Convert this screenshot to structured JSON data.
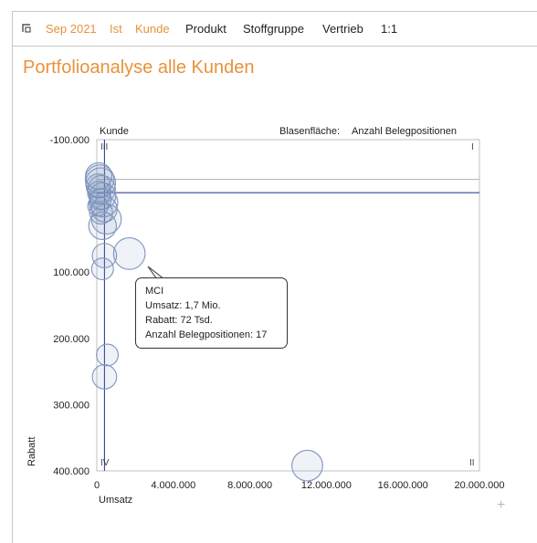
{
  "toolbar": {
    "items": [
      {
        "label": "Sep 2021",
        "accent": true
      },
      {
        "label": "Ist",
        "accent": true
      },
      {
        "label": "Kunde",
        "accent": true
      },
      {
        "label": "Produkt",
        "accent": false
      },
      {
        "label": "Stoffgruppe",
        "accent": false
      },
      {
        "label": "Vertrieb",
        "accent": false
      },
      {
        "label": "1:1",
        "accent": false
      }
    ]
  },
  "page_title": "Portfolioanalyse alle Kunden",
  "colors": {
    "accent": "#e8923a",
    "bubble": "#7f95bd",
    "mean_line": "#1f2d8f"
  },
  "chart_data": {
    "type": "scatter",
    "series_label": "Kunde",
    "size_label": "Blasenfläche:",
    "size_value": "Anzahl Belegpositionen",
    "xlabel": "Umsatz",
    "ylabel": "Rabatt",
    "xlim": [
      0,
      20000000
    ],
    "ylim": [
      -100000,
      400000
    ],
    "y_inverted": true,
    "x_ticks": [
      "0",
      "4.000.000",
      "8.000.000",
      "12.000.000",
      "16.000.000",
      "20.000.000"
    ],
    "y_ticks": [
      "-100.000",
      "100.000",
      "200.000",
      "300.000",
      "400.000"
    ],
    "quadrants": [
      "III",
      "I",
      "IV",
      "II"
    ],
    "mean_x": 400000,
    "mean_y": -20000,
    "ref_y": -40000,
    "points": [
      {
        "x": 100000,
        "y": -45000,
        "size": 12
      },
      {
        "x": 150000,
        "y": -40000,
        "size": 14
      },
      {
        "x": 200000,
        "y": -35000,
        "size": 15
      },
      {
        "x": 80000,
        "y": -30000,
        "size": 10
      },
      {
        "x": 250000,
        "y": -25000,
        "size": 13
      },
      {
        "x": 120000,
        "y": -20000,
        "size": 9
      },
      {
        "x": 300000,
        "y": -15000,
        "size": 12
      },
      {
        "x": 180000,
        "y": -10000,
        "size": 8
      },
      {
        "x": 350000,
        "y": -5000,
        "size": 14
      },
      {
        "x": 60000,
        "y": 0,
        "size": 7
      },
      {
        "x": 400000,
        "y": 5000,
        "size": 11
      },
      {
        "x": 220000,
        "y": 10000,
        "size": 9
      },
      {
        "x": 500000,
        "y": 20000,
        "size": 15
      },
      {
        "x": 300000,
        "y": 30000,
        "size": 13
      },
      {
        "x": 1700000,
        "y": 72000,
        "size": 17
      },
      {
        "x": 400000,
        "y": 75000,
        "size": 10
      },
      {
        "x": 300000,
        "y": 95000,
        "size": 8
      },
      {
        "x": 550000,
        "y": 225000,
        "size": 8
      },
      {
        "x": 400000,
        "y": 258000,
        "size": 10
      },
      {
        "x": 11000000,
        "y": 392000,
        "size": 16
      }
    ]
  },
  "tooltip": {
    "name": "MCI",
    "line1": "Umsatz: 1,7 Mio.",
    "line2": "Rabatt: 72 Tsd.",
    "line3": "Anzahl Belegpositionen: 17"
  },
  "add_icon": "+"
}
